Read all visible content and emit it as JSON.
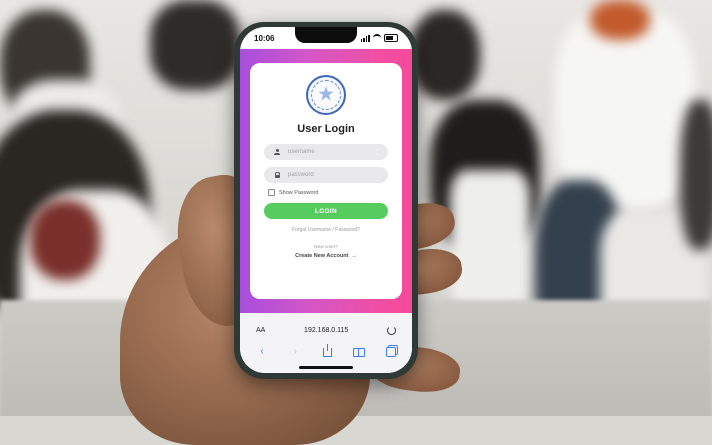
{
  "status_bar": {
    "time": "10:06"
  },
  "login": {
    "title": "User Login",
    "username_placeholder": "username",
    "password_placeholder": "password",
    "show_password_label": "Show Password",
    "login_button_label": "LOGIN",
    "forgot_link": "Forgot Username / Password?",
    "new_user_text": "New User?",
    "create_account_link": "Create New Account",
    "create_account_arrow": "→"
  },
  "browser": {
    "text_size_label": "AA",
    "url": "192.168.0.115"
  },
  "colors": {
    "gradient_start": "#a64fdd",
    "gradient_end": "#f7499a",
    "login_button": "#57cc5e",
    "safari_accent": "#3b7cf0"
  },
  "icons": [
    "signal-icon",
    "wifi-icon",
    "battery-icon",
    "logo-star-icon",
    "user-icon",
    "lock-icon",
    "reload-icon",
    "back-icon",
    "forward-icon",
    "share-icon",
    "bookmarks-icon",
    "tabs-icon"
  ]
}
